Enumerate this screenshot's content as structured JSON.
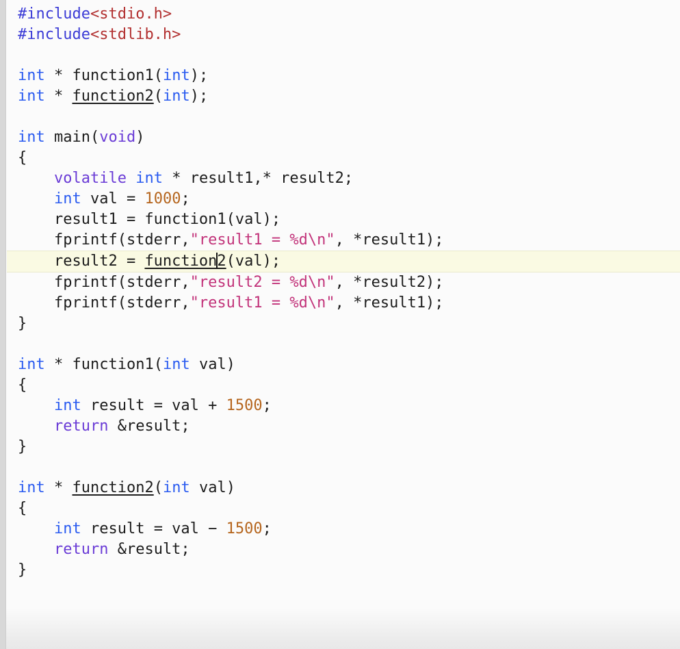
{
  "editor": {
    "language": "C",
    "cursor_line_index": 9,
    "cursor_token_label": "function2-call",
    "colors": {
      "background": "#fbfbfb",
      "gutter": "#d8d8d8",
      "current_line_highlight": "#fafae3",
      "preprocessor": "#3b3bd6",
      "header_name": "#b23030",
      "type_keyword": "#2a5bf0",
      "keyword": "#6a3bd6",
      "number": "#b5651d",
      "string": "#c2337a",
      "plain_text": "#1c1c1c"
    },
    "lines": [
      {
        "n": 1,
        "current": false,
        "tokens": [
          {
            "t": "#include",
            "c": "pp"
          },
          {
            "t": "<stdio.h>",
            "c": "header"
          }
        ]
      },
      {
        "n": 2,
        "current": false,
        "tokens": [
          {
            "t": "#include",
            "c": "pp"
          },
          {
            "t": "<stdlib.h>",
            "c": "header"
          }
        ]
      },
      {
        "n": 3,
        "current": false,
        "tokens": []
      },
      {
        "n": 4,
        "current": false,
        "tokens": [
          {
            "t": "int",
            "c": "type"
          },
          {
            "t": " ",
            "c": "plain"
          },
          {
            "t": "*",
            "c": "plain"
          },
          {
            "t": " function1(",
            "c": "plain"
          },
          {
            "t": "int",
            "c": "type"
          },
          {
            "t": ");",
            "c": "plain"
          }
        ]
      },
      {
        "n": 5,
        "current": false,
        "tokens": [
          {
            "t": "int",
            "c": "type"
          },
          {
            "t": " ",
            "c": "plain"
          },
          {
            "t": "*",
            "c": "plain"
          },
          {
            "t": " ",
            "c": "plain"
          },
          {
            "t": "function2",
            "c": "plain",
            "u": true
          },
          {
            "t": "(",
            "c": "plain"
          },
          {
            "t": "int",
            "c": "type"
          },
          {
            "t": ");",
            "c": "plain"
          }
        ]
      },
      {
        "n": 6,
        "current": false,
        "tokens": []
      },
      {
        "n": 7,
        "current": false,
        "tokens": [
          {
            "t": "int",
            "c": "type"
          },
          {
            "t": " main(",
            "c": "plain"
          },
          {
            "t": "void",
            "c": "kw"
          },
          {
            "t": ")",
            "c": "plain"
          }
        ]
      },
      {
        "n": 8,
        "current": false,
        "tokens": [
          {
            "t": "{",
            "c": "plain"
          }
        ]
      },
      {
        "n": 9,
        "current": false,
        "tokens": [
          {
            "t": "    ",
            "c": "plain"
          },
          {
            "t": "volatile",
            "c": "kw"
          },
          {
            "t": " ",
            "c": "plain"
          },
          {
            "t": "int",
            "c": "type"
          },
          {
            "t": " ",
            "c": "plain"
          },
          {
            "t": "*",
            "c": "plain"
          },
          {
            "t": " result1,",
            "c": "plain"
          },
          {
            "t": "*",
            "c": "plain"
          },
          {
            "t": " result2;",
            "c": "plain"
          }
        ]
      },
      {
        "n": 10,
        "current": false,
        "tokens": [
          {
            "t": "    ",
            "c": "plain"
          },
          {
            "t": "int",
            "c": "type"
          },
          {
            "t": " val = ",
            "c": "plain"
          },
          {
            "t": "1000",
            "c": "num"
          },
          {
            "t": ";",
            "c": "plain"
          }
        ]
      },
      {
        "n": 11,
        "current": false,
        "tokens": [
          {
            "t": "    result1 = function1(val);",
            "c": "plain"
          }
        ]
      },
      {
        "n": 12,
        "current": false,
        "tokens": [
          {
            "t": "    fprintf(stderr,",
            "c": "plain"
          },
          {
            "t": "\"result1 = %d\\n\"",
            "c": "str"
          },
          {
            "t": ", ",
            "c": "plain"
          },
          {
            "t": "*",
            "c": "plain"
          },
          {
            "t": "result1);",
            "c": "plain"
          }
        ]
      },
      {
        "n": 13,
        "current": true,
        "tokens": [
          {
            "t": "    result2 = ",
            "c": "plain"
          },
          {
            "t": "function",
            "c": "plain",
            "u": true
          },
          {
            "t": "",
            "c": "caret"
          },
          {
            "t": "2",
            "c": "plain",
            "u": true
          },
          {
            "t": "(val);",
            "c": "plain"
          }
        ]
      },
      {
        "n": 14,
        "current": false,
        "tokens": [
          {
            "t": "    fprintf(stderr,",
            "c": "plain"
          },
          {
            "t": "\"result2 = %d\\n\"",
            "c": "str"
          },
          {
            "t": ", ",
            "c": "plain"
          },
          {
            "t": "*",
            "c": "plain"
          },
          {
            "t": "result2);",
            "c": "plain"
          }
        ]
      },
      {
        "n": 15,
        "current": false,
        "tokens": [
          {
            "t": "    fprintf(stderr,",
            "c": "plain"
          },
          {
            "t": "\"result1 = %d\\n\"",
            "c": "str"
          },
          {
            "t": ", ",
            "c": "plain"
          },
          {
            "t": "*",
            "c": "plain"
          },
          {
            "t": "result1);",
            "c": "plain"
          }
        ]
      },
      {
        "n": 16,
        "current": false,
        "tokens": [
          {
            "t": "}",
            "c": "plain"
          }
        ]
      },
      {
        "n": 17,
        "current": false,
        "tokens": []
      },
      {
        "n": 18,
        "current": false,
        "tokens": [
          {
            "t": "int",
            "c": "type"
          },
          {
            "t": " ",
            "c": "plain"
          },
          {
            "t": "*",
            "c": "plain"
          },
          {
            "t": " function1(",
            "c": "plain"
          },
          {
            "t": "int",
            "c": "type"
          },
          {
            "t": " val)",
            "c": "plain"
          }
        ]
      },
      {
        "n": 19,
        "current": false,
        "tokens": [
          {
            "t": "{",
            "c": "plain"
          }
        ]
      },
      {
        "n": 20,
        "current": false,
        "tokens": [
          {
            "t": "    ",
            "c": "plain"
          },
          {
            "t": "int",
            "c": "type"
          },
          {
            "t": " result = val + ",
            "c": "plain"
          },
          {
            "t": "1500",
            "c": "num"
          },
          {
            "t": ";",
            "c": "plain"
          }
        ]
      },
      {
        "n": 21,
        "current": false,
        "tokens": [
          {
            "t": "    ",
            "c": "plain"
          },
          {
            "t": "return",
            "c": "kw"
          },
          {
            "t": " &result;",
            "c": "plain"
          }
        ]
      },
      {
        "n": 22,
        "current": false,
        "tokens": [
          {
            "t": "}",
            "c": "plain"
          }
        ]
      },
      {
        "n": 23,
        "current": false,
        "tokens": []
      },
      {
        "n": 24,
        "current": false,
        "tokens": [
          {
            "t": "int",
            "c": "type"
          },
          {
            "t": " ",
            "c": "plain"
          },
          {
            "t": "*",
            "c": "plain"
          },
          {
            "t": " ",
            "c": "plain"
          },
          {
            "t": "function2",
            "c": "plain",
            "u": true
          },
          {
            "t": "(",
            "c": "plain"
          },
          {
            "t": "int",
            "c": "type"
          },
          {
            "t": " val)",
            "c": "plain"
          }
        ]
      },
      {
        "n": 25,
        "current": false,
        "tokens": [
          {
            "t": "{",
            "c": "plain"
          }
        ]
      },
      {
        "n": 26,
        "current": false,
        "tokens": [
          {
            "t": "    ",
            "c": "plain"
          },
          {
            "t": "int",
            "c": "type"
          },
          {
            "t": " result = val ",
            "c": "plain"
          },
          {
            "t": "−",
            "c": "plain"
          },
          {
            "t": " ",
            "c": "plain"
          },
          {
            "t": "1500",
            "c": "num"
          },
          {
            "t": ";",
            "c": "plain"
          }
        ]
      },
      {
        "n": 27,
        "current": false,
        "tokens": [
          {
            "t": "    ",
            "c": "plain"
          },
          {
            "t": "return",
            "c": "kw"
          },
          {
            "t": " &result;",
            "c": "plain"
          }
        ]
      },
      {
        "n": 28,
        "current": false,
        "tokens": [
          {
            "t": "}",
            "c": "plain"
          }
        ]
      },
      {
        "n": 29,
        "current": false,
        "tokens": []
      },
      {
        "n": 30,
        "current": false,
        "tokens": []
      }
    ]
  }
}
